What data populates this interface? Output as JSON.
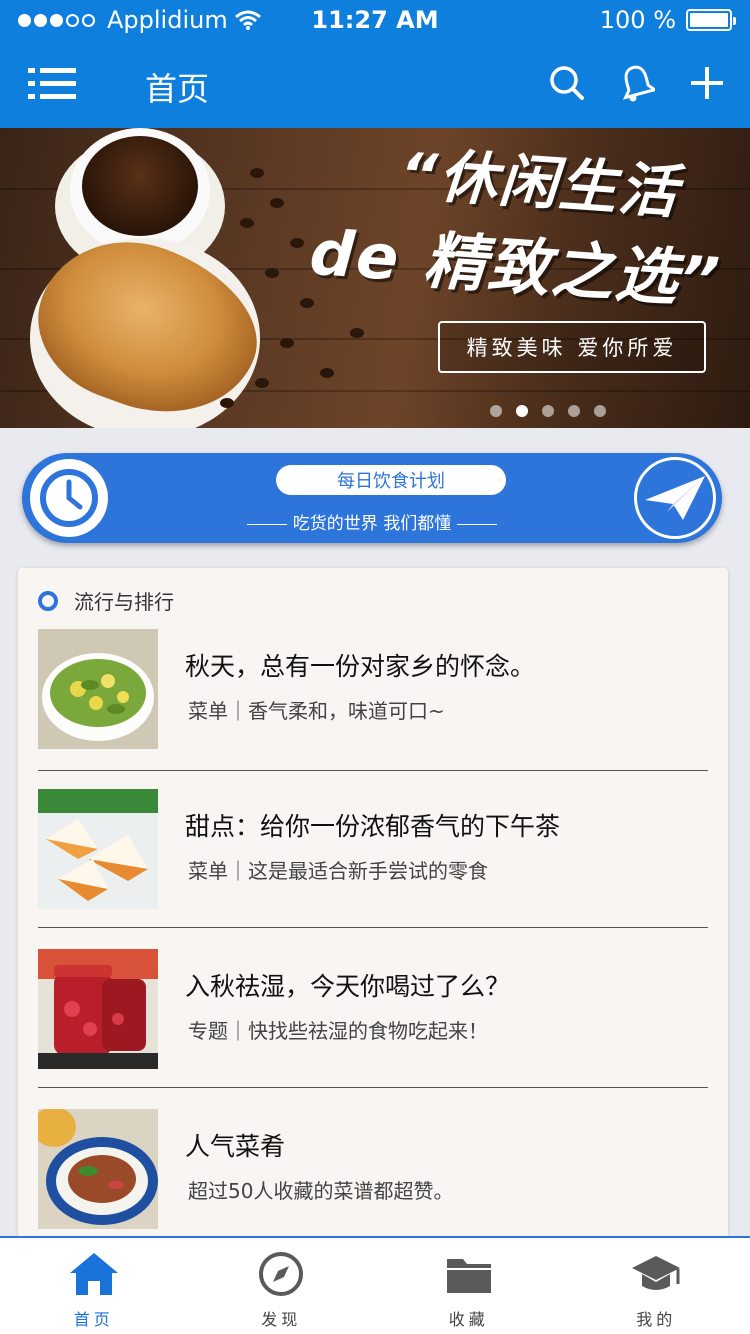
{
  "status_bar": {
    "carrier": "Applidium",
    "time": "11:27 AM",
    "battery": "100 %",
    "signal_bars_filled": 3,
    "signal_bars_total": 5
  },
  "nav": {
    "title": "首页",
    "icons": [
      "menu-icon",
      "search-icon",
      "bell-icon",
      "plus-icon"
    ]
  },
  "banner": {
    "headline_line1": "休闲生活",
    "headline_line2": "de 精致之选",
    "tagline": "精致美味  爱你所爱",
    "page_count": 5,
    "active_page": 2
  },
  "plan": {
    "label": "每日饮食计划",
    "subtitle": "吃货的世界 我们都懂"
  },
  "section": {
    "title": "流行与排行",
    "items": [
      {
        "title": "秋天，总有一份对家乡的怀念。",
        "desc": "菜单｜香气柔和，味道可口~"
      },
      {
        "title": "甜点：给你一份浓郁香气的下午茶",
        "desc": "菜单｜这是最适合新手尝试的零食"
      },
      {
        "title": "入秋祛湿，今天你喝过了么？",
        "desc": "专题｜快找些祛湿的食物吃起来！"
      },
      {
        "title": "人气菜肴",
        "desc": "超过50人收藏的菜谱都超赞。"
      }
    ]
  },
  "tabs": [
    {
      "label": "首页",
      "icon": "home-icon",
      "active": true
    },
    {
      "label": "发现",
      "icon": "compass-icon",
      "active": false
    },
    {
      "label": "收藏",
      "icon": "folder-icon",
      "active": false
    },
    {
      "label": "我的",
      "icon": "graduation-cap-icon",
      "active": false
    }
  ],
  "colors": {
    "brand_blue": "#0f7fde",
    "accent_blue": "#2d74db",
    "active_tab": "#1a73d9",
    "inactive_tab": "#5a5a5a"
  }
}
